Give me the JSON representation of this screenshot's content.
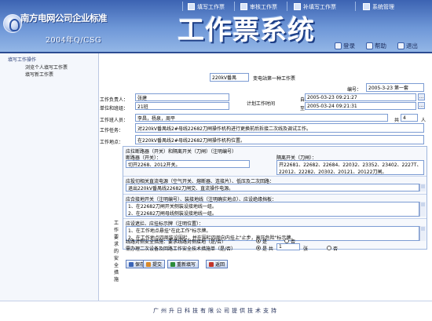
{
  "top_menu": [
    {
      "label": "填写工作票",
      "icon": "edit-icon"
    },
    {
      "label": "审核工作票",
      "icon": "approve-icon"
    },
    {
      "label": "补填写工作票",
      "icon": "edit-icon"
    },
    {
      "label": "系统管理",
      "icon": "gear-icon"
    }
  ],
  "header": {
    "company": "南方电网公司企业标准",
    "subtitle": "2004年Q/CSG",
    "app_title": "工作票系统"
  },
  "sub_nav": [
    {
      "label": "登录",
      "icon": "login-icon"
    },
    {
      "label": "帮助",
      "icon": "help-icon"
    },
    {
      "label": "退出",
      "icon": "exit-icon"
    }
  ],
  "sidebar": {
    "heading": "填写工作操作",
    "items": [
      "浏览个人填写工作票",
      "填写新工作票"
    ]
  },
  "form": {
    "substation_value": "220kV番禺",
    "ticket_type": "变电站第一种工作票",
    "number_label": "编号：",
    "number_value": "2005-3-23 第一套",
    "person_in_charge_label": "工作负责人：",
    "person_in_charge_value": "张建",
    "dept_label": "单位和班组：",
    "dept_value": "21班",
    "plan_time_label": "计划工作时间",
    "from_label": "自",
    "from_value": "2005-03-23 09:21:27",
    "to_label": "至",
    "to_value": "2005-03-24 09:21:31",
    "members_label": "工作班人员：",
    "members_value": "李昌，杨泉，周平",
    "total_label": "共",
    "total_value": "4",
    "total_unit": "人",
    "task_label": "工作任务：",
    "task_value": "对220kV番禺线2#母线22682刀闸操作机构进行更换前后拆接二次线及调试工作。",
    "location_label": "工作地点：",
    "location_value": "在220kV番禺线2#母线22682刀闸操作机构位置。",
    "safety_label": "工作要求的安全措施",
    "sec1_heading": "应拉断路器（开关）和隔离开关（刀闸）（注明编号）",
    "breaker_label": "断路器（开关）：",
    "breaker_value": "切开2268、2012开关。",
    "isolator_label": "隔离开关（刀闸）：",
    "isolator_value": "开22681、22682、22684、22032、23352、23402、2227T、\n22012、22282、20302、20121、20122刀闸。",
    "sec2_heading": "应投切相关直流电源（空气开关、熔断器、连接片）、低压及二次回路：",
    "sec2_value": "退出220kV番禺线22682刀闸交、直流操作电源。",
    "sec3_heading": "应合接地开关（注明编号）、装接地线（注明确实地点）、应设绝缘挡板：",
    "sec3_value": "1、在22682刀闸开关侧装设接地线一组。\n2、在22682刀闸母线侧装设接地线一组。",
    "sec4_heading": "应设遮拦、应挂标示牌（注明位置）：",
    "sec4_value": "1、在工作地点悬挂\"在此工作\"标示牌。\n2、在工作地点四周装设围栏，并在围栏四周向内挂上\"止步，高压危险\"标示牌。",
    "q1_label": "线路对侧安全措施：要求线路对侧接地（是/否）",
    "q1_yes": "是",
    "q1_no": "否",
    "q2_label": "需办理二次设备及回路工作安全技术措施单（是/否）",
    "q2_yes": "是 共",
    "q2_count": "1",
    "q2_unit": "张",
    "q2_no": "否"
  },
  "buttons": [
    {
      "label": "保存",
      "icon": "save-icon"
    },
    {
      "label": "提交",
      "icon": "submit-icon"
    },
    {
      "label": "重新填写",
      "icon": "reset-icon"
    },
    {
      "label": "返回",
      "icon": "back-icon"
    }
  ],
  "footer": {
    "text": "广州升日科技有限公司提供技术支持"
  }
}
